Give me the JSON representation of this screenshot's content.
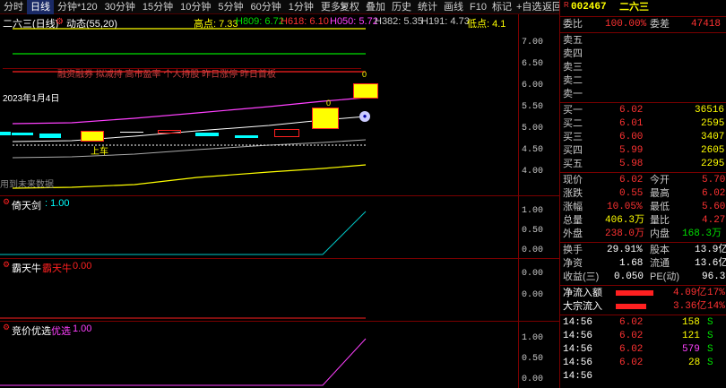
{
  "toolbar": {
    "tabs": [
      "分时",
      "日线",
      "分钟*120",
      "30分钟",
      "15分钟",
      "10分钟",
      "5分钟",
      "60分钟",
      "1分钟",
      "更多>"
    ],
    "selected": "日线",
    "right": [
      "复权",
      "叠加",
      "历史",
      "统计",
      "画线",
      "F10",
      "标记",
      "+自选",
      "返回"
    ]
  },
  "chart": {
    "title": "二六三(日线)",
    "dynamic": "动态(55,20)",
    "high_label": "高点: 7.33",
    "h809": "H809: 6.72",
    "h618": "H618: 6.10",
    "h050": "H050: 5.72",
    "h382": "H382: 5.35",
    "h191": "H191: 4.73",
    "low_label": "低点: 4.1",
    "tags": "融资融券 拟减持 高市盈率 个人持股 昨日涨停 昨日首板",
    "date_label": "2023年1月4日",
    "up_label": "上车",
    "marker_top": "0",
    "marker_mid": "0",
    "future_data": "用到未来数据",
    "y_ticks": [
      "7.00",
      "6.50",
      "6.00",
      "5.50",
      "5.00",
      "4.50",
      "4.00"
    ]
  },
  "pane2": {
    "name": "倚天剑",
    "value": ": 1.00",
    "y_ticks": [
      "1.00",
      "0.50",
      "0.00"
    ]
  },
  "pane3": {
    "name": "霸天牛",
    "sub": "霸天牛",
    "value": "0.00",
    "y_ticks": [
      "0.00",
      "0.00"
    ]
  },
  "pane4": {
    "name": "竞价优选",
    "sub": "优选",
    "value": "1.00",
    "y_ticks": [
      "1.00",
      "0.50",
      "0.00"
    ]
  },
  "quote": {
    "r_mark": "R",
    "code": "002467",
    "name": "二六三",
    "weibi_label": "委比",
    "weibi_value": "100.00%",
    "weicha_label": "委差",
    "weicha_value": "47418",
    "sell_labels": [
      "卖五",
      "卖四",
      "卖三",
      "卖二",
      "卖一"
    ],
    "buy": [
      {
        "label": "买一",
        "price": "6.02",
        "vol": "36516"
      },
      {
        "label": "买二",
        "price": "6.01",
        "vol": "2595"
      },
      {
        "label": "买三",
        "price": "6.00",
        "vol": "3407"
      },
      {
        "label": "买四",
        "price": "5.99",
        "vol": "2605"
      },
      {
        "label": "买五",
        "price": "5.98",
        "vol": "2295"
      }
    ],
    "stats": [
      {
        "l1": "现价",
        "v1": "6.02",
        "c1": "red",
        "l2": "今开",
        "v2": "5.70",
        "c2": "red"
      },
      {
        "l1": "涨跌",
        "v1": "0.55",
        "c1": "red",
        "l2": "最高",
        "v2": "6.02",
        "c2": "red"
      },
      {
        "l1": "涨幅",
        "v1": "10.05%",
        "c1": "red",
        "l2": "最低",
        "v2": "5.60",
        "c2": "red"
      },
      {
        "l1": "总量",
        "v1": "406.3万",
        "c1": "yellow",
        "l2": "量比",
        "v2": "4.27",
        "c2": "red"
      },
      {
        "l1": "外盘",
        "v1": "238.0万",
        "c1": "red",
        "l2": "内盘",
        "v2": "168.3万",
        "c2": "green"
      }
    ],
    "stats2": [
      {
        "l1": "换手",
        "v1": "29.91%",
        "l2": "股本",
        "v2": "13.9亿"
      },
      {
        "l1": "净资",
        "v1": "1.68",
        "l2": "流通",
        "v2": "13.6亿"
      },
      {
        "l1": "收益(三)",
        "v1": "0.050",
        "l2": "PE(动)",
        "v2": "96.3"
      }
    ],
    "flows": [
      {
        "label": "净流入额",
        "value": "4.09亿",
        "pct": "17%",
        "bar": 1.0
      },
      {
        "label": "大宗流入",
        "value": "3.36亿",
        "pct": "14%",
        "bar": 0.82
      }
    ],
    "ticks": [
      {
        "time": "14:56",
        "price": "6.02",
        "vol": "158",
        "side": "S"
      },
      {
        "time": "14:56",
        "price": "6.02",
        "vol": "121",
        "side": "S"
      },
      {
        "time": "14:56",
        "price": "6.02",
        "vol": "579",
        "side": "S"
      },
      {
        "time": "14:56",
        "price": "6.02",
        "vol": "28",
        "side": "S"
      },
      {
        "time": "14:56",
        "price": "",
        "vol": "",
        "side": ""
      }
    ]
  }
}
